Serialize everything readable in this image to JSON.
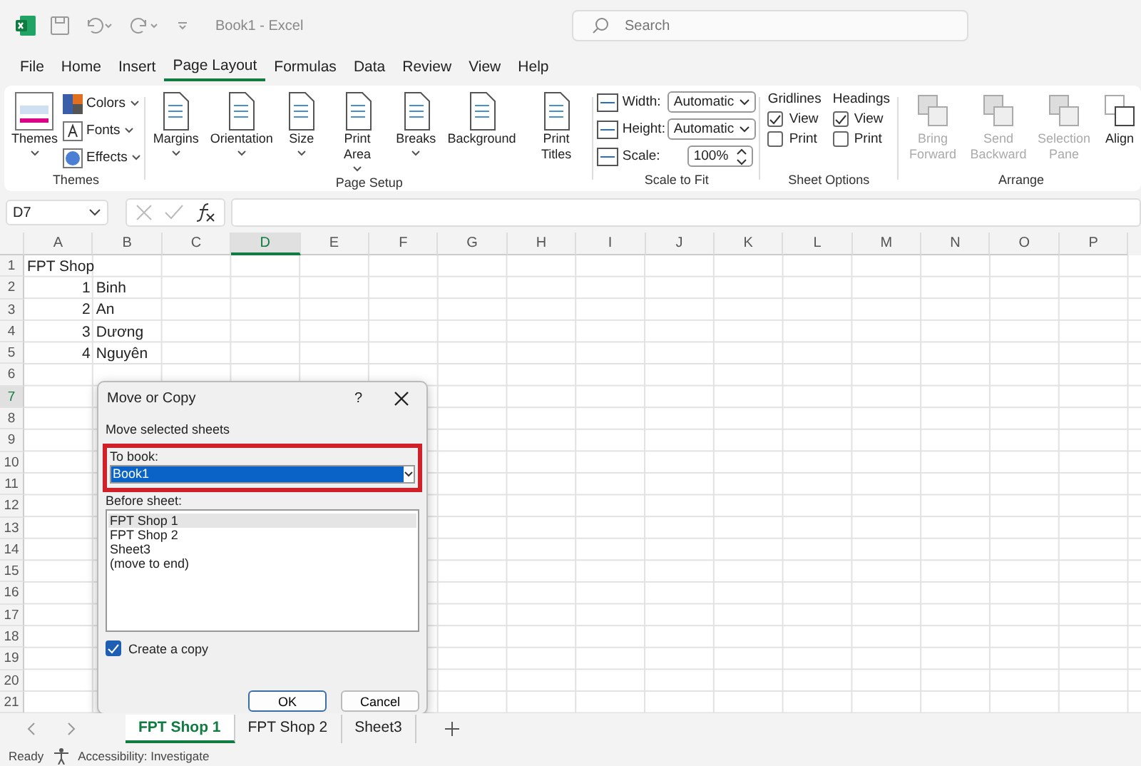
{
  "title_bar": {
    "document_title": "Book1  -  Excel",
    "search": {
      "placeholder": "Search"
    }
  },
  "menu_tabs": [
    {
      "label": "File",
      "selected": false
    },
    {
      "label": "Home",
      "selected": false
    },
    {
      "label": "Insert",
      "selected": false
    },
    {
      "label": "Page Layout",
      "selected": true
    },
    {
      "label": "Formulas",
      "selected": false
    },
    {
      "label": "Data",
      "selected": false
    },
    {
      "label": "Review",
      "selected": false
    },
    {
      "label": "View",
      "selected": false
    },
    {
      "label": "Help",
      "selected": false
    }
  ],
  "ribbon": {
    "groups": [
      {
        "kind": "themes",
        "label": "Themes",
        "large": {
          "label": "Themes"
        },
        "small": [
          {
            "label": "Colors"
          },
          {
            "label": "Fonts"
          },
          {
            "label": "Effects"
          }
        ]
      },
      {
        "kind": "page_setup",
        "label": "Page Setup",
        "buttons": [
          {
            "label": "Margins",
            "caret": true
          },
          {
            "label": "Orientation",
            "caret": true
          },
          {
            "label": "Size",
            "caret": true
          },
          {
            "label": "Print Area",
            "caret": true
          },
          {
            "label": "Breaks",
            "caret": true
          },
          {
            "label": "Background",
            "caret": false
          },
          {
            "label": "Print Titles",
            "caret": false
          }
        ]
      },
      {
        "kind": "scale",
        "label": "Scale to Fit",
        "rows": [
          {
            "label": "Width:",
            "value": "Automatic",
            "kind": "dropdown"
          },
          {
            "label": "Height:",
            "value": "Automatic",
            "kind": "dropdown"
          },
          {
            "label": "Scale:",
            "value": "100%",
            "kind": "spinner"
          }
        ]
      },
      {
        "kind": "sheet_options",
        "label": "Sheet Options",
        "columns": [
          {
            "title": "Gridlines",
            "options": [
              {
                "label": "View",
                "checked": true
              },
              {
                "label": "Print",
                "checked": false
              }
            ]
          },
          {
            "title": "Headings",
            "options": [
              {
                "label": "View",
                "checked": true
              },
              {
                "label": "Print",
                "checked": false
              }
            ]
          }
        ]
      },
      {
        "kind": "arrange",
        "label": "Arrange",
        "buttons": [
          {
            "label": "Bring Forward",
            "disabled": true
          },
          {
            "label": "Send Backward",
            "disabled": true
          },
          {
            "label": "Selection Pane",
            "disabled": true
          },
          {
            "label": "Align",
            "disabled": false
          }
        ]
      }
    ]
  },
  "formula_bar": {
    "name_box": "D7"
  },
  "sheet": {
    "columns": [
      {
        "label": "A",
        "selected": false
      },
      {
        "label": "B",
        "selected": false
      },
      {
        "label": "C",
        "selected": false
      },
      {
        "label": "D",
        "selected": true
      },
      {
        "label": "E",
        "selected": false
      },
      {
        "label": "F",
        "selected": false
      },
      {
        "label": "G",
        "selected": false
      },
      {
        "label": "H",
        "selected": false
      },
      {
        "label": "I",
        "selected": false
      },
      {
        "label": "J",
        "selected": false
      },
      {
        "label": "K",
        "selected": false
      },
      {
        "label": "L",
        "selected": false
      },
      {
        "label": "M",
        "selected": false
      },
      {
        "label": "N",
        "selected": false
      },
      {
        "label": "O",
        "selected": false
      },
      {
        "label": "P",
        "selected": false
      }
    ],
    "rows": [
      {
        "header": "1",
        "selected": false,
        "cells": [
          {
            "text": "FPT Shop",
            "kind": "text"
          }
        ]
      },
      {
        "header": "2",
        "selected": false,
        "cells": [
          {
            "text": "1",
            "kind": "number"
          },
          {
            "text": "Binh",
            "kind": "text"
          }
        ]
      },
      {
        "header": "3",
        "selected": false,
        "cells": [
          {
            "text": "2",
            "kind": "number"
          },
          {
            "text": "An",
            "kind": "text"
          }
        ]
      },
      {
        "header": "4",
        "selected": false,
        "cells": [
          {
            "text": "3",
            "kind": "number"
          },
          {
            "text": "Dương",
            "kind": "text"
          }
        ]
      },
      {
        "header": "5",
        "selected": false,
        "cells": [
          {
            "text": "4",
            "kind": "number"
          },
          {
            "text": "Nguyên",
            "kind": "text"
          }
        ]
      },
      {
        "header": "6",
        "selected": false
      },
      {
        "header": "7",
        "selected": true
      },
      {
        "header": "8",
        "selected": false
      },
      {
        "header": "9",
        "selected": false
      },
      {
        "header": "10",
        "selected": false
      },
      {
        "header": "11",
        "selected": false
      },
      {
        "header": "12",
        "selected": false
      },
      {
        "header": "13",
        "selected": false
      },
      {
        "header": "14",
        "selected": false
      },
      {
        "header": "15",
        "selected": false
      },
      {
        "header": "16",
        "selected": false
      },
      {
        "header": "17",
        "selected": false
      },
      {
        "header": "18",
        "selected": false
      },
      {
        "header": "19",
        "selected": false
      },
      {
        "header": "20",
        "selected": false
      },
      {
        "header": "21",
        "selected": false
      }
    ]
  },
  "dialog": {
    "title": "Move or Copy",
    "help": "?",
    "subtitle": "Move selected sheets",
    "to_book_label": "To book:",
    "to_book_value": "Book1",
    "before_sheet_label": "Before sheet:",
    "sheets": [
      {
        "label": "FPT Shop 1",
        "selected": true
      },
      {
        "label": "FPT Shop 2",
        "selected": false
      },
      {
        "label": "Sheet3",
        "selected": false
      },
      {
        "label": "(move to end)",
        "selected": false
      }
    ],
    "create_copy": {
      "label": "Create a copy",
      "checked": true
    },
    "buttons": [
      {
        "label": "OK",
        "kind": "default"
      },
      {
        "label": "Cancel",
        "kind": "normal"
      }
    ]
  },
  "sheet_tabs": [
    {
      "label": "FPT Shop 1",
      "selected": true
    },
    {
      "label": "FPT Shop 2",
      "selected": false
    },
    {
      "label": "Sheet3",
      "selected": false
    }
  ],
  "status_bar": {
    "state": "Ready",
    "accessibility": "Accessibility: Investigate"
  }
}
